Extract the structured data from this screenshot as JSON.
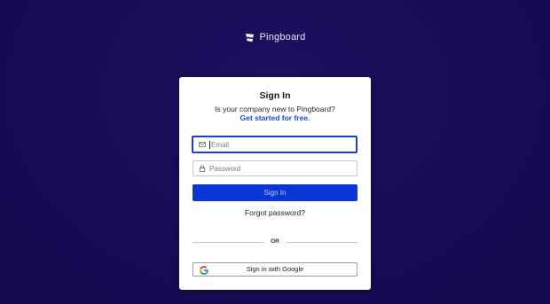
{
  "brand": {
    "name": "Pingboard",
    "logo_icon": "pingboard-logo-icon"
  },
  "signin": {
    "title": "Sign In",
    "subtitle": "Is your company new to Pingboard?",
    "signup_link": "Get started for free.",
    "email": {
      "placeholder": "Email",
      "value": "",
      "icon": "envelope-icon"
    },
    "password": {
      "placeholder": "Password",
      "value": "",
      "icon": "lock-icon"
    },
    "submit_label": "Sign In",
    "forgot_label": "Forgot password?",
    "divider_label": "OR",
    "google_label": "Sign in with Google",
    "google_icon": "google-icon"
  },
  "colors": {
    "background": "#170c55",
    "primary_button": "#0a36d6",
    "link": "#1a46d6",
    "focus_border": "#1a3fd4"
  }
}
